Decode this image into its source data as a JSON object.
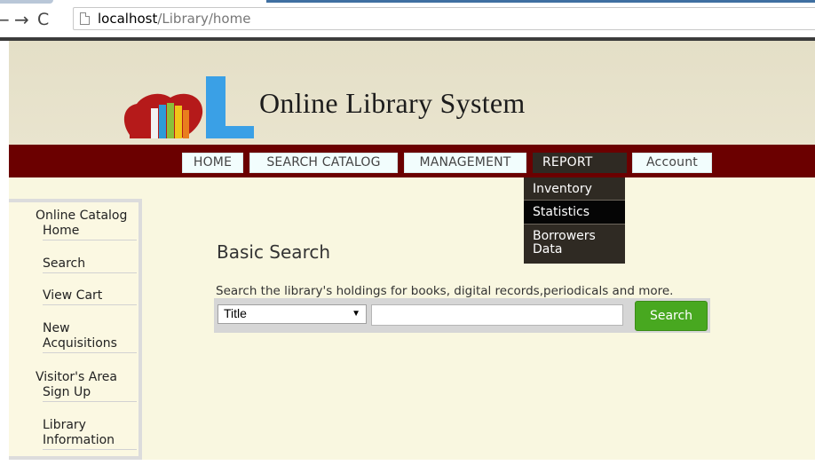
{
  "browser": {
    "back_glyph": "←",
    "forward_glyph": "→",
    "reload_glyph": "C",
    "url_host": "localhost",
    "url_path": "/Library/home"
  },
  "site": {
    "title": "Online Library System",
    "logo_letter": "L"
  },
  "nav": {
    "home": "HOME",
    "search_catalog": "SEARCH CATALOG",
    "management": "MANAGEMENT",
    "report": "REPORT",
    "account": "Account"
  },
  "report_menu": {
    "inventory": "Inventory",
    "statistics": "Statistics",
    "borrowers_line1": "Borrowers",
    "borrowers_line2": "Data"
  },
  "sidebar": {
    "online_catalog": "Online Catalog",
    "home": "Home",
    "search": "Search",
    "view_cart": "View Cart",
    "new_line1": "New",
    "new_line2": "Acquisitions",
    "visitors_area": "Visitor's Area",
    "sign_up": "Sign Up",
    "library_line1": "Library",
    "library_line2": "Information"
  },
  "search": {
    "heading": "Basic Search",
    "description": "Search the library's holdings for books, digital records,periodicals and more.",
    "field_selected": "Title",
    "query_value": "",
    "button_label": "Search"
  },
  "colors": {
    "navbar": "#6b0000",
    "header": "#e4dfc7",
    "content_bg": "#f9f7e0",
    "search_button": "#48a820",
    "dropdown": "#2f2a23"
  }
}
